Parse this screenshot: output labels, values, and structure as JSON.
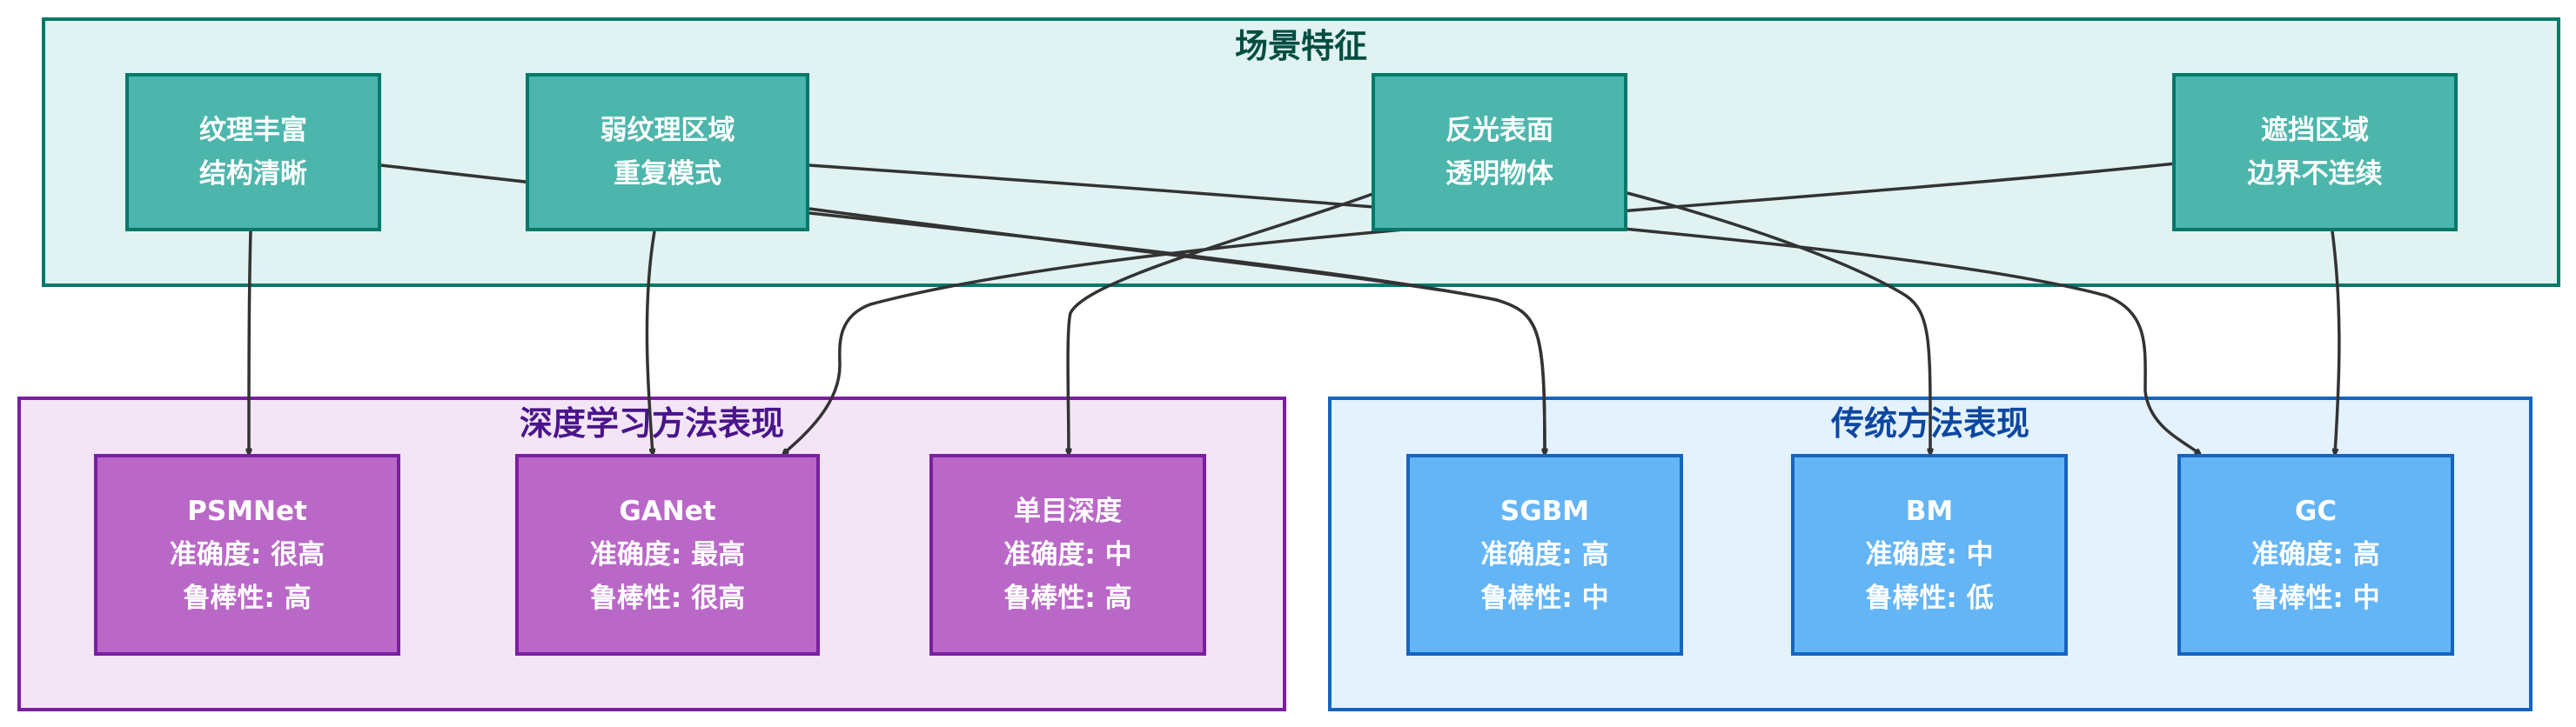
{
  "groups": {
    "scene": "场景特征",
    "deep": "深度学习方法表现",
    "traditional": "传统方法表现"
  },
  "scene_nodes": [
    {
      "line1": "纹理丰富",
      "line2": "结构清晰"
    },
    {
      "line1": "弱纹理区域",
      "line2": "重复模式"
    },
    {
      "line1": "反光表面",
      "line2": "透明物体"
    },
    {
      "line1": "遮挡区域",
      "line2": "边界不连续"
    }
  ],
  "deep_nodes": [
    {
      "name": "PSMNet",
      "accuracy": "准确度: 很高",
      "robustness": "鲁棒性: 高"
    },
    {
      "name": "GANet",
      "accuracy": "准确度: 最高",
      "robustness": "鲁棒性: 很高"
    },
    {
      "name": "单目深度",
      "accuracy": "准确度: 中",
      "robustness": "鲁棒性: 高"
    }
  ],
  "traditional_nodes": [
    {
      "name": "SGBM",
      "accuracy": "准确度: 高",
      "robustness": "鲁棒性: 中"
    },
    {
      "name": "BM",
      "accuracy": "准确度: 中",
      "robustness": "鲁棒性: 低"
    },
    {
      "name": "GC",
      "accuracy": "准确度: 高",
      "robustness": "鲁棒性: 中"
    }
  ],
  "edges": [
    {
      "from": "纹理丰富",
      "to": "PSMNet"
    },
    {
      "from": "纹理丰富",
      "to": "SGBM"
    },
    {
      "from": "弱纹理区域",
      "to": "GANet"
    },
    {
      "from": "弱纹理区域",
      "to": "SGBM"
    },
    {
      "from": "弱纹理区域",
      "to": "GC"
    },
    {
      "from": "反光表面",
      "to": "单目深度"
    },
    {
      "from": "反光表面",
      "to": "BM"
    },
    {
      "from": "遮挡区域",
      "to": "GANet"
    },
    {
      "from": "遮挡区域",
      "to": "GC"
    }
  ],
  "colors": {
    "scene_fill": "#4db6ac",
    "scene_border": "#00796b",
    "scene_bg": "#e0f2f1",
    "deep_fill": "#ba68c8",
    "deep_border": "#7b1fa2",
    "deep_bg": "#f3e5f5",
    "trad_fill": "#64b5f6",
    "trad_border": "#1565c0",
    "trad_bg": "#e3f2fd",
    "edge": "#333333"
  }
}
